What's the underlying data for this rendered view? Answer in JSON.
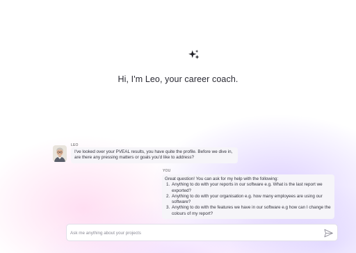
{
  "header": {
    "sparkle_icon": "sparkle-icon",
    "greeting": "Hi, I'm Leo, your career coach."
  },
  "chat": {
    "messages": [
      {
        "sender": "LEO",
        "avatar_icon": "avatar",
        "text": "I've looked over your PVEAL results, you have quite the profile. Before we dive in, are there any pressing matters or goals you'd like to address?"
      },
      {
        "sender": "YOU",
        "intro": "Great question! You can ask for my help with the following:",
        "items": [
          "Anything to do with your reports in our software e.g. What is the last report we exported?",
          "Anything to do with your organisation e.g. how many employees are using our software?",
          "Anything to do with the features we have in our software e.g how can I change the colours of my report?"
        ]
      }
    ]
  },
  "composer": {
    "placeholder": "Ask me anything about your projects",
    "value": "",
    "send_icon": "send-icon"
  },
  "colors": {
    "bubble_bg": "#f6f5f9",
    "text": "#2b2b33",
    "pink_glow": "#ffc4e8",
    "purple_glow": "#c4acff"
  }
}
